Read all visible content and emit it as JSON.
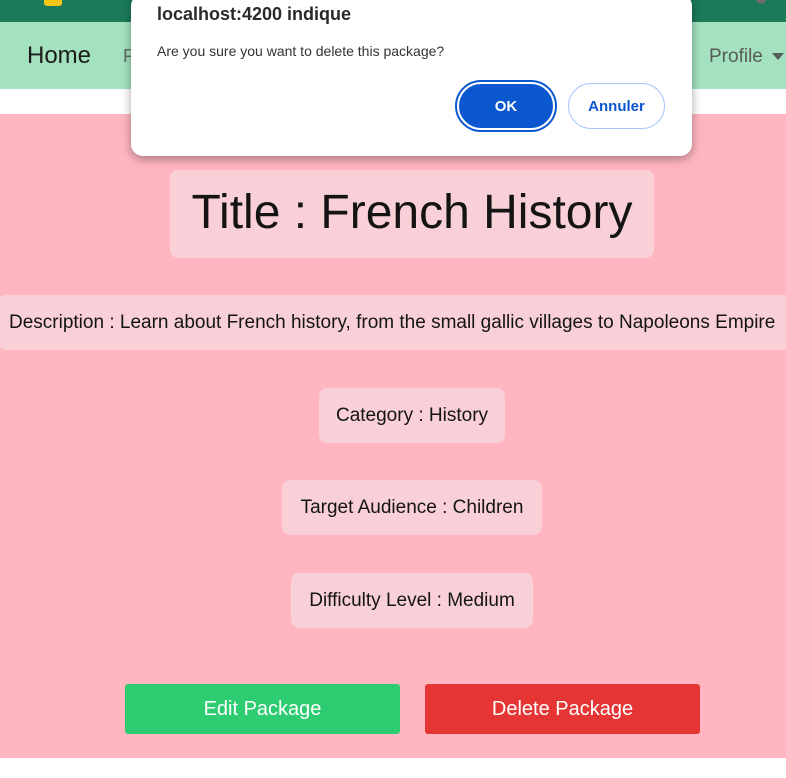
{
  "colors": {
    "topbar": "#1b7a5a",
    "navbar": "#a3e1bf",
    "page_background": "#ffb6c1",
    "card_background": "#f9d0d8",
    "edit_button": "#2ecc71",
    "delete_button": "#e53535",
    "dialog_primary": "#0b57d0"
  },
  "navbar": {
    "home_label": "Home",
    "partial_item": "P",
    "profile_label": "Profile",
    "profile_caret_icon": "caret-down-icon"
  },
  "package": {
    "title": "Title : French History",
    "description": "Description : Learn about French history, from the small gallic villages to Napoleons Empire",
    "category": "Category : History",
    "target_audience": "Target Audience : Children",
    "difficulty": "Difficulty Level : Medium"
  },
  "actions": {
    "edit_label": "Edit Package",
    "delete_label": "Delete Package"
  },
  "dialog": {
    "title": "localhost:4200 indique",
    "message": "Are you sure you want to delete this package?",
    "ok_label": "OK",
    "cancel_label": "Annuler"
  }
}
